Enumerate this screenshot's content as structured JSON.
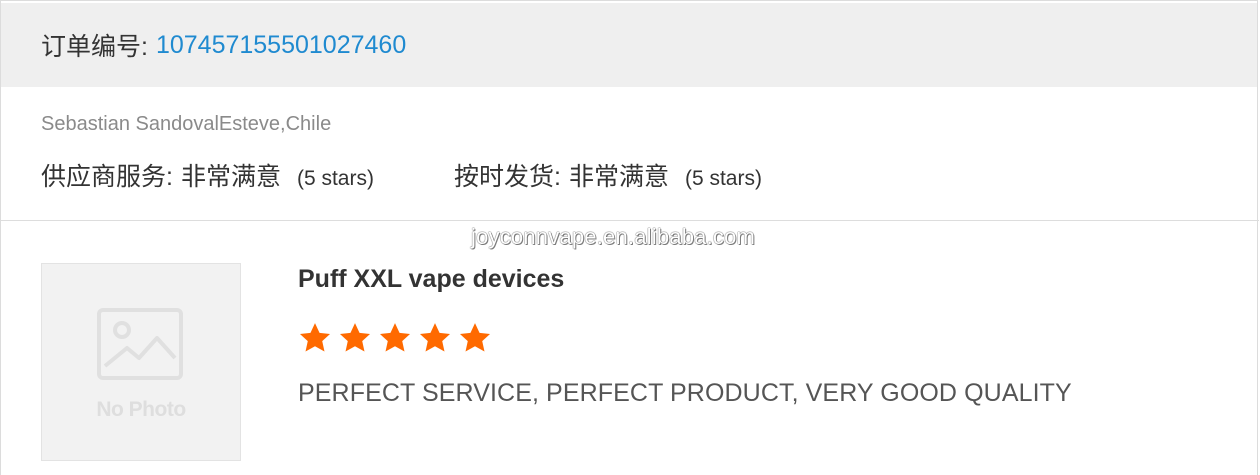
{
  "order": {
    "label": "订单编号:",
    "number": "107457155501027460"
  },
  "review": {
    "reviewer": "Sebastian SandovalEsteve,Chile",
    "supplier_service": {
      "label": "供应商服务:",
      "value": "非常满意",
      "stars_text": "(5 stars)"
    },
    "on_time_delivery": {
      "label": "按时发货:",
      "value": "非常满意",
      "stars_text": "(5 stars)"
    }
  },
  "watermark": "joyconnvape.en.alibaba.com",
  "product": {
    "thumbnail_text": "No Photo",
    "title": "Puff XXL vape devices",
    "rating": 5,
    "rating_max": 5,
    "review_text": "PERFECT SERVICE, PERFECT PRODUCT, VERY GOOD QUALITY"
  },
  "colors": {
    "header_bg": "#efefef",
    "link_blue": "#1f8ad0",
    "star_orange": "#ff6a00"
  }
}
